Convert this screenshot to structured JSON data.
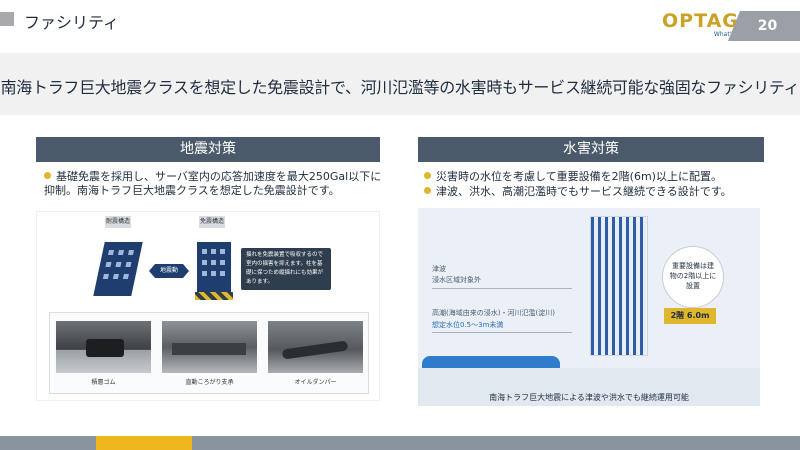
{
  "header": {
    "title": "ファシリティ",
    "page_number": "20"
  },
  "logo": {
    "main": "OPTAGE",
    "tagline": "What's next?"
  },
  "banner": {
    "text": "南海トラフ巨大地震クラスを想定した免震設計で、河川氾濫等の水害時もサービス継続可能な強固なファシリティ"
  },
  "earthquake": {
    "heading": "地震対策",
    "bullets": [
      "基礎免震を採用し、サーバ室内の応答加速度を最大250Gal以下に抑制。南海トラフ巨大地震クラスを想定した免震設計です。"
    ],
    "figure": {
      "tag_left": "耐震構造",
      "tag_right": "免震構造",
      "arrow_label": "地震動",
      "callout": "揺れを免震装置で吸収するので室内の揺害を抑えます。柱を基礎に保つため縦揺れにも効果があります。",
      "photos": [
        "積層ゴム",
        "直動ころがり支承",
        "オイルダンパー"
      ]
    }
  },
  "flood": {
    "heading": "水害対策",
    "bullets": [
      "災害時の水位を考慮して重要設備を2階(6m)以上に配置。",
      "津波、洪水、高潮氾濫時でもサービス継続できる設計です。"
    ],
    "figure": {
      "tsunami_label": "津波",
      "tsunami_value": "浸水区域対象外",
      "tide_label": "高潮(海域由来の浸水)・河川氾濫(淀川)",
      "tide_value": "想定水位0.5〜3m未満",
      "bubble": "重要設備は建物の2階以上に設置",
      "floor_tag": "2階 6.0m",
      "caption": "南海トラフ巨大地震による津波や洪水でも継続運用可能"
    }
  }
}
